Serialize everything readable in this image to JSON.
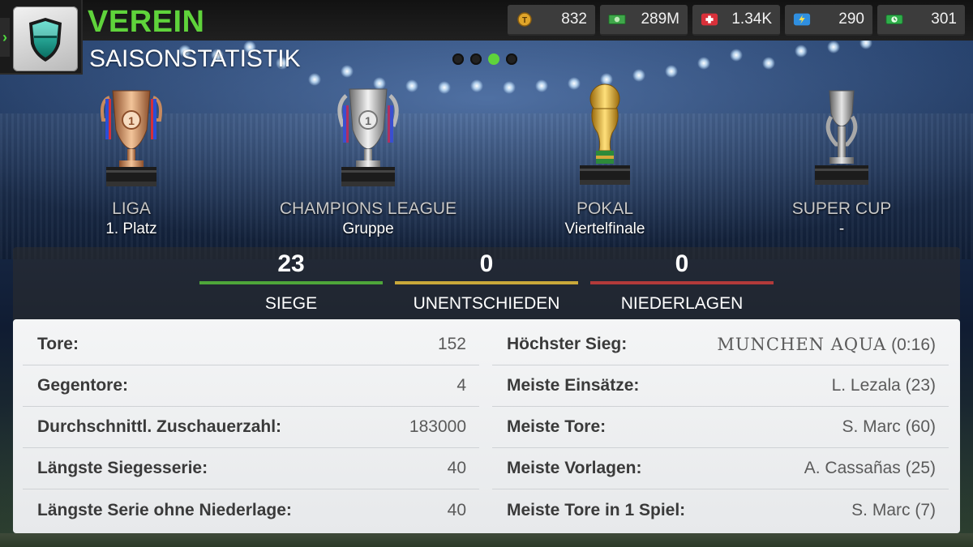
{
  "header": {
    "title": "VEREIN",
    "subtitle": "SAISONSTATISTIK",
    "side_tab_glyph": "›",
    "logo_icon": "shield-icon"
  },
  "resources": [
    {
      "icon": "token-coin-icon",
      "value": "832",
      "color": "#e0a52a"
    },
    {
      "icon": "money-icon",
      "value": "289M",
      "color": "#3fa74a"
    },
    {
      "icon": "medical-icon",
      "value": "1.34K",
      "color": "#d9303a"
    },
    {
      "icon": "energy-icon",
      "value": "290",
      "color": "#2f8fe0"
    },
    {
      "icon": "time-money-icon",
      "value": "301",
      "color": "#2fae4a"
    }
  ],
  "pagination": {
    "count": 4,
    "active_index": 2
  },
  "trophies": [
    {
      "icon": "league-trophy-icon",
      "name": "LIGA",
      "result": "1. Platz"
    },
    {
      "icon": "champions-league-trophy-icon",
      "name": "CHAMPIONS LEAGUE",
      "result": "Gruppe"
    },
    {
      "icon": "cup-trophy-icon",
      "name": "POKAL",
      "result": "Viertelfinale"
    },
    {
      "icon": "super-cup-trophy-icon",
      "name": "SUPER CUP",
      "result": "-"
    }
  ],
  "record": [
    {
      "value": "23",
      "label": "SIEGE",
      "color": "#4ea63a"
    },
    {
      "value": "0",
      "label": "UNENTSCHIEDEN",
      "color": "#c9a83a"
    },
    {
      "value": "0",
      "label": "NIEDERLAGEN",
      "color": "#b23a3a"
    }
  ],
  "stats_left": [
    {
      "label": "Tore:",
      "value": "152"
    },
    {
      "label": "Gegentore:",
      "value": "4"
    },
    {
      "label": "Durchschnittl. Zuschauerzahl:",
      "value": "183000"
    },
    {
      "label": "Längste Siegesserie:",
      "value": "40"
    },
    {
      "label": "Längste Serie ohne Niederlage:",
      "value": "40"
    }
  ],
  "stats_right": [
    {
      "label": "Höchster Sieg:",
      "value": "MUNCHEN AQUA",
      "suffix": " (0:16)"
    },
    {
      "label": "Meiste Einsätze:",
      "value": "L. Lezala (23)"
    },
    {
      "label": "Meiste Tore:",
      "value": "S. Marc (60)"
    },
    {
      "label": "Meiste Vorlagen:",
      "value": "A. Cassañas (25)"
    },
    {
      "label": "Meiste Tore in 1 Spiel:",
      "value": "S. Marc (7)"
    }
  ]
}
